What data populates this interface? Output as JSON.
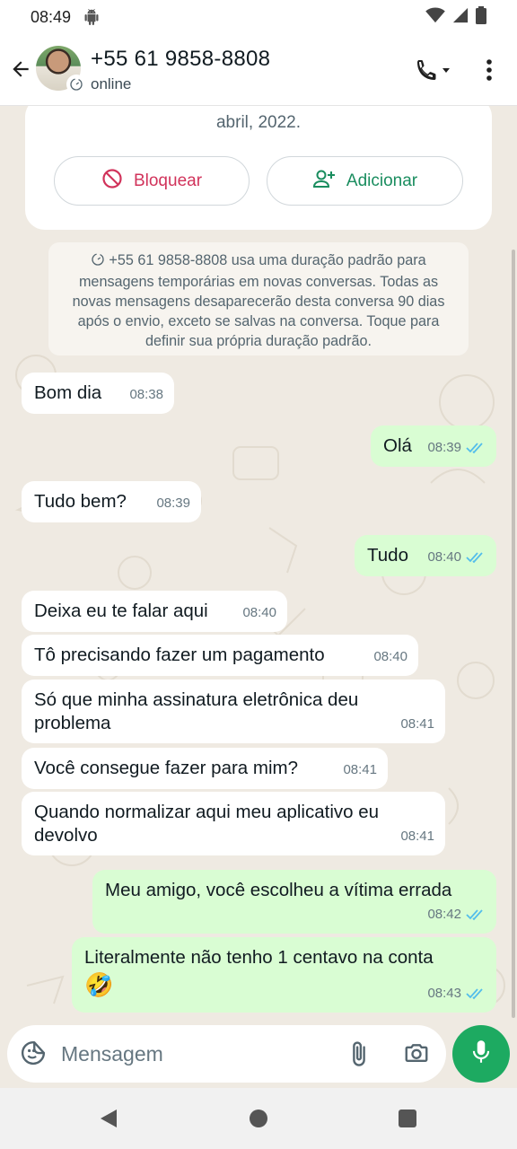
{
  "status_bar": {
    "time": "08:49"
  },
  "header": {
    "contact_name": "+55 61 9858-8808",
    "contact_status": "online"
  },
  "contact_card": {
    "date_text": "abril, 2022.",
    "block_label": "Bloquear",
    "add_label": "Adicionar"
  },
  "system_message": {
    "text": "+55 61 9858-8808 usa uma duração padrão para mensagens temporárias em novas conversas. Todas as novas mensagens desaparecerão desta conversa 90 dias após o envio, exceto se salvas na conversa. Toque para definir sua própria duração padrão."
  },
  "messages": [
    {
      "direction": "in",
      "text": "Bom dia",
      "time": "08:38"
    },
    {
      "direction": "out",
      "text": "Olá",
      "time": "08:39",
      "read": true
    },
    {
      "direction": "in",
      "text": "Tudo bem?",
      "time": "08:39"
    },
    {
      "direction": "out",
      "text": "Tudo",
      "time": "08:40",
      "read": true
    },
    {
      "direction": "in",
      "text": "Deixa eu te falar aqui",
      "time": "08:40"
    },
    {
      "direction": "in",
      "text": "Tô precisando fazer um pagamento",
      "time": "08:40"
    },
    {
      "direction": "in",
      "text": "Só que minha assinatura eletrônica deu problema",
      "time": "08:41"
    },
    {
      "direction": "in",
      "text": "Você consegue fazer para mim?",
      "time": "08:41"
    },
    {
      "direction": "in",
      "text": "Quando normalizar aqui meu aplicativo eu devolvo",
      "time": "08:41"
    },
    {
      "direction": "out",
      "text": "Meu amigo, você escolheu a vítima errada",
      "time": "08:42",
      "read": true
    },
    {
      "direction": "out",
      "text": "Literalmente não tenho 1 centavo na conta",
      "emoji": "🤣",
      "time": "08:43",
      "read": true
    }
  ],
  "composer": {
    "placeholder": "Mensagem"
  },
  "colors": {
    "accent_green": "#1daa61",
    "outgoing_bubble": "#d9fdd3",
    "read_ticks": "#53bdeb",
    "block_red": "#d1335b",
    "add_green": "#1a8d5f",
    "chat_background": "#efeae2"
  },
  "icons": {
    "back": "arrow-left-icon",
    "call": "phone-dropdown-icon",
    "menu": "more-vert-icon",
    "block": "block-icon",
    "add": "person-add-icon",
    "timer": "disappearing-timer-icon",
    "emoji": "emoji-sticker-icon",
    "attach": "paperclip-icon",
    "camera": "camera-icon",
    "mic": "mic-icon"
  }
}
